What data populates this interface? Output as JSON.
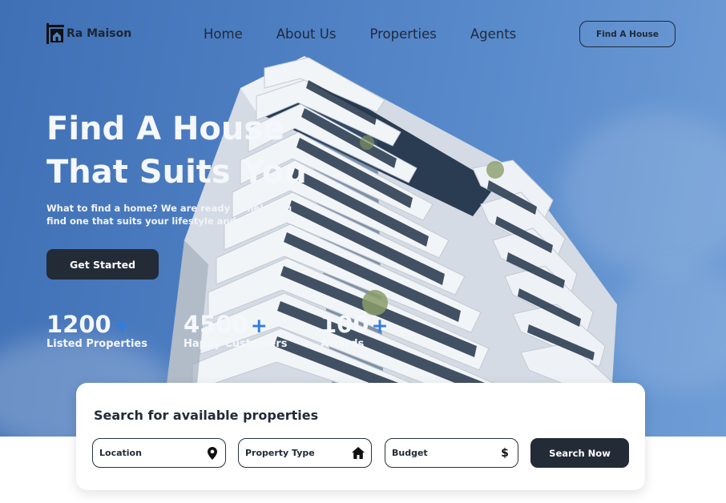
{
  "brand": {
    "name": "Ra Maison"
  },
  "nav": {
    "links": [
      "Home",
      "About Us",
      "Properties",
      "Agents"
    ],
    "cta_label": "Find A House"
  },
  "hero": {
    "title_line1": "Find A House",
    "title_line2": "That Suits You",
    "subtitle": "What to find a home? We are ready to help you find one that suits your lifestyle and needs",
    "cta_label": "Get Started"
  },
  "stats": [
    {
      "value": "1200",
      "plus": "+",
      "label": "Listed Properties"
    },
    {
      "value": "4500",
      "plus": "+",
      "label": "Happy Customers"
    },
    {
      "value": "100",
      "plus": "+",
      "label": "Awards"
    }
  ],
  "search": {
    "title": "Search for available properties",
    "fields": [
      {
        "label": "Location",
        "icon": "map-pin-icon"
      },
      {
        "label": "Property Type",
        "icon": "home-icon"
      },
      {
        "label": "Budget",
        "icon": "dollar-icon"
      }
    ],
    "button_label": "Search Now"
  },
  "colors": {
    "dark": "#232b36",
    "accent_plus": "#2f7de1",
    "sky": "#4d7ec2"
  }
}
